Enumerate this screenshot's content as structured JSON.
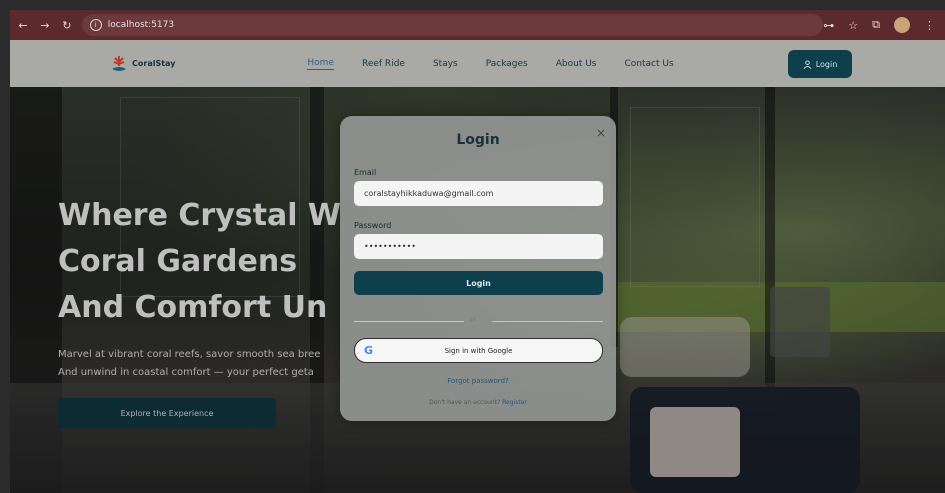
{
  "browser": {
    "url": "localhost:5173",
    "back": "←",
    "forward": "→",
    "reload": "↻",
    "tools": [
      "⊶",
      "☆",
      "⧉",
      "⋮"
    ]
  },
  "site": {
    "brand": "CoralStay",
    "nav": [
      {
        "label": "Home",
        "active": true
      },
      {
        "label": "Reef Ride"
      },
      {
        "label": "Stays"
      },
      {
        "label": "Packages"
      },
      {
        "label": "About Us"
      },
      {
        "label": "Contact Us"
      }
    ],
    "login_label": "Login",
    "login_icon": "user-icon",
    "accent": "#0f3f4c"
  },
  "hero": {
    "title_lines": [
      "Where Crystal W",
      "Coral Gardens",
      "And Comfort Un"
    ],
    "subtitle_lines": [
      "Marvel at vibrant coral reefs, savor smooth sea bree",
      "And unwind in coastal comfort — your perfect geta"
    ],
    "cta": "Explore the Experience"
  },
  "modal": {
    "title": "Login",
    "close": "×",
    "email_label": "Email",
    "email_value": "coralstayhikkaduwa@gmail.com",
    "password_label": "Password",
    "password_value": "•••••••••••",
    "submit": "Login",
    "or": "or",
    "google_icon": "G",
    "google_label": "Sign in with Google",
    "forgot": "Forgot password?",
    "no_account": "Don't have an account?",
    "register": "Register"
  }
}
